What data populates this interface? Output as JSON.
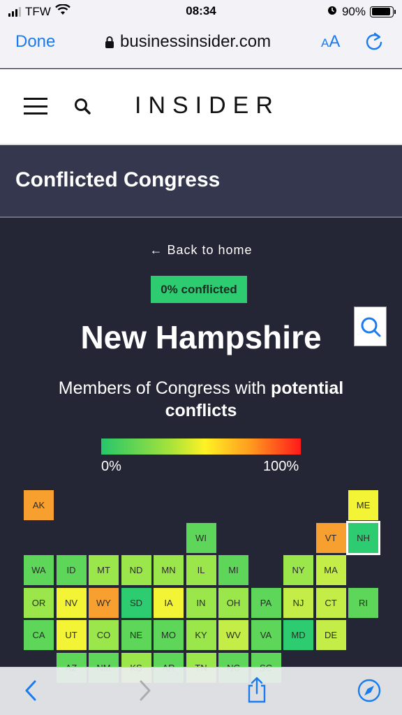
{
  "status_bar": {
    "carrier": "TFW",
    "time": "08:34",
    "battery": "90%",
    "battery_level": 0.9
  },
  "browser": {
    "done_label": "Done",
    "url": "businessinsider.com",
    "text_size_small": "A",
    "text_size_large": "A"
  },
  "site": {
    "logo": "INSIDER"
  },
  "app_bar": {
    "title": "Conflicted Congress"
  },
  "main": {
    "back_label": "← Back to home",
    "badge": "0% conflicted",
    "state_name": "New Hampshire",
    "subtitle_prefix": "Members of Congress with ",
    "subtitle_bold": "potential conflicts",
    "scale_low": "0%",
    "scale_high": "100%"
  },
  "colors": {
    "background": "#242535",
    "app_bar": "#34374e",
    "accent": "#1a7bf0",
    "badge": "#2ecc71",
    "tile_0": "#2ecc71",
    "tile_1": "#5ed65a",
    "tile_2": "#9be64b",
    "tile_3": "#c4ed47",
    "tile_4": "#f4f436",
    "tile_5": "#f7a030"
  },
  "tiles": [
    {
      "abbr": "AK",
      "col": 0,
      "row": 0,
      "level": 5
    },
    {
      "abbr": "ME",
      "col": 10,
      "row": 0,
      "level": 4
    },
    {
      "abbr": "WI",
      "col": 5,
      "row": 1,
      "level": 1
    },
    {
      "abbr": "VT",
      "col": 9,
      "row": 1,
      "level": 5
    },
    {
      "abbr": "NH",
      "col": 10,
      "row": 1,
      "level": 0,
      "selected": true
    },
    {
      "abbr": "WA",
      "col": 0,
      "row": 2,
      "level": 1
    },
    {
      "abbr": "ID",
      "col": 1,
      "row": 2,
      "level": 1
    },
    {
      "abbr": "MT",
      "col": 2,
      "row": 2,
      "level": 2
    },
    {
      "abbr": "ND",
      "col": 3,
      "row": 2,
      "level": 2
    },
    {
      "abbr": "MN",
      "col": 4,
      "row": 2,
      "level": 2
    },
    {
      "abbr": "IL",
      "col": 5,
      "row": 2,
      "level": 2
    },
    {
      "abbr": "MI",
      "col": 6,
      "row": 2,
      "level": 1
    },
    {
      "abbr": "NY",
      "col": 8,
      "row": 2,
      "level": 2
    },
    {
      "abbr": "MA",
      "col": 9,
      "row": 2,
      "level": 3
    },
    {
      "abbr": "OR",
      "col": 0,
      "row": 3,
      "level": 2
    },
    {
      "abbr": "NV",
      "col": 1,
      "row": 3,
      "level": 4
    },
    {
      "abbr": "WY",
      "col": 2,
      "row": 3,
      "level": 5
    },
    {
      "abbr": "SD",
      "col": 3,
      "row": 3,
      "level": 0
    },
    {
      "abbr": "IA",
      "col": 4,
      "row": 3,
      "level": 4
    },
    {
      "abbr": "IN",
      "col": 5,
      "row": 3,
      "level": 2
    },
    {
      "abbr": "OH",
      "col": 6,
      "row": 3,
      "level": 2
    },
    {
      "abbr": "PA",
      "col": 7,
      "row": 3,
      "level": 1
    },
    {
      "abbr": "NJ",
      "col": 8,
      "row": 3,
      "level": 3
    },
    {
      "abbr": "CT",
      "col": 9,
      "row": 3,
      "level": 3
    },
    {
      "abbr": "RI",
      "col": 10,
      "row": 3,
      "level": 1
    },
    {
      "abbr": "CA",
      "col": 0,
      "row": 4,
      "level": 1
    },
    {
      "abbr": "UT",
      "col": 1,
      "row": 4,
      "level": 4
    },
    {
      "abbr": "CO",
      "col": 2,
      "row": 4,
      "level": 2
    },
    {
      "abbr": "NE",
      "col": 3,
      "row": 4,
      "level": 1
    },
    {
      "abbr": "MO",
      "col": 4,
      "row": 4,
      "level": 1
    },
    {
      "abbr": "KY",
      "col": 5,
      "row": 4,
      "level": 2
    },
    {
      "abbr": "WV",
      "col": 6,
      "row": 4,
      "level": 3
    },
    {
      "abbr": "VA",
      "col": 7,
      "row": 4,
      "level": 1
    },
    {
      "abbr": "MD",
      "col": 8,
      "row": 4,
      "level": 0
    },
    {
      "abbr": "DE",
      "col": 9,
      "row": 4,
      "level": 3
    },
    {
      "abbr": "AZ",
      "col": 1,
      "row": 5,
      "level": 1
    },
    {
      "abbr": "NM",
      "col": 2,
      "row": 5,
      "level": 1
    },
    {
      "abbr": "KS",
      "col": 3,
      "row": 5,
      "level": 2
    },
    {
      "abbr": "AR",
      "col": 4,
      "row": 5,
      "level": 1
    },
    {
      "abbr": "TN",
      "col": 5,
      "row": 5,
      "level": 2
    },
    {
      "abbr": "NC",
      "col": 6,
      "row": 5,
      "level": 1
    },
    {
      "abbr": "SC",
      "col": 7,
      "row": 5,
      "level": 1
    }
  ],
  "toolbar": {
    "back_icon": "chevron-left-icon",
    "forward_icon": "chevron-right-icon",
    "share_icon": "share-icon",
    "safari_icon": "compass-icon"
  }
}
